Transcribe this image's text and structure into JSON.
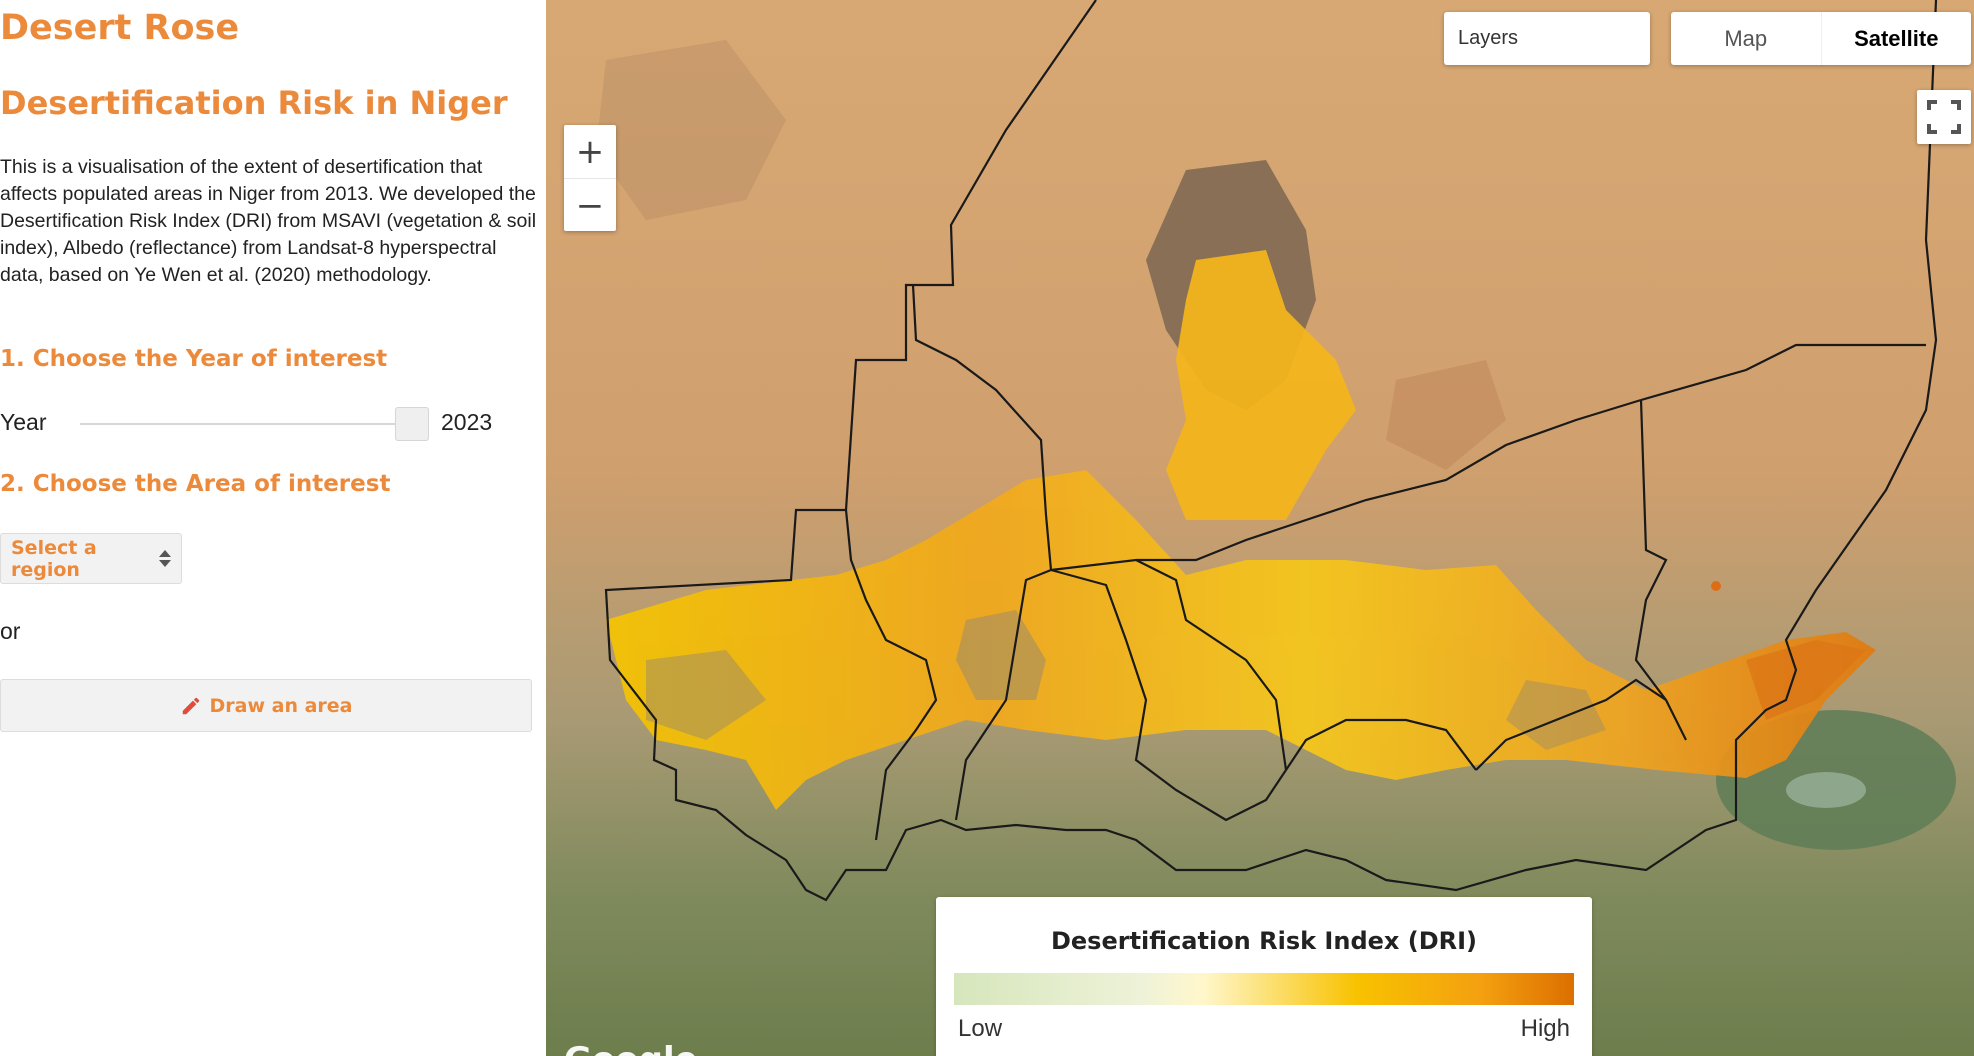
{
  "app": {
    "title": "Desert Rose"
  },
  "page": {
    "title": "Desertification Risk in Niger",
    "description": "This is a visualisation of the extent of desertification that affects populated areas in Niger from 2013. We developed the Desertification Risk Index (DRI) from MSAVI (vegetation & soil index), Albedo (reflectance) from Landsat-8 hyperspectral data, based on Ye Wen et al. (2020) methodology."
  },
  "step1": {
    "heading": "1. Choose the Year of interest",
    "year_label": "Year",
    "year_value": "2023"
  },
  "step2": {
    "heading": "2. Choose the Area of interest",
    "select_label": "Select a region",
    "or_text": "or",
    "draw_button_label": "Draw an area",
    "draw_icon": "pencil-icon"
  },
  "map": {
    "zoom_in": "+",
    "zoom_out": "−",
    "layers_label": "Layers",
    "map_type_map": "Map",
    "map_type_satellite": "Satellite",
    "selected_map_type": "Satellite",
    "fullscreen_icon": "fullscreen-icon",
    "attribution": "Google"
  },
  "legend": {
    "title": "Desertification Risk Index (DRI)",
    "low": "Low",
    "high": "High",
    "colors": [
      "#d6e6bc",
      "#fff7cc",
      "#f8c200",
      "#f4a010",
      "#dc6f00"
    ]
  },
  "colors": {
    "accent": "#ec8a3c"
  }
}
